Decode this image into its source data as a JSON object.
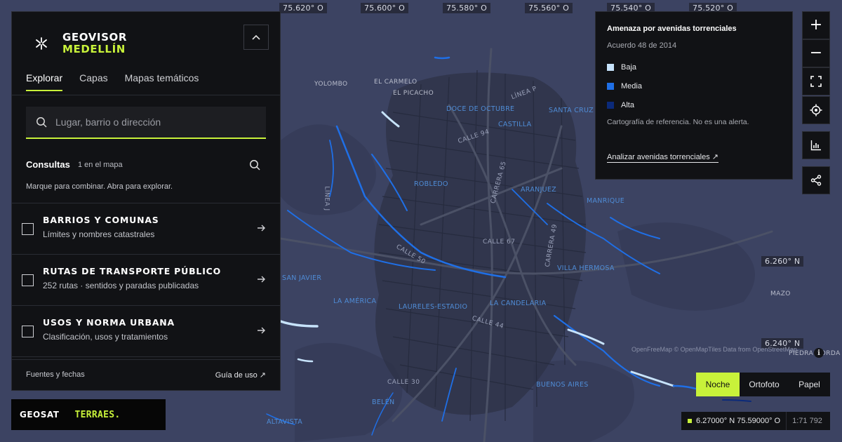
{
  "brand": {
    "line1": "GEOVISOR",
    "line2": "MEDELLÍN"
  },
  "tabs": [
    {
      "label": "Explorar",
      "active": true
    },
    {
      "label": "Capas",
      "active": false
    },
    {
      "label": "Mapas temáticos",
      "active": false
    }
  ],
  "search": {
    "placeholder": "Lugar, barrio o dirección"
  },
  "consultas": {
    "title": "Consultas",
    "count": "1 en el mapa",
    "hint": "Marque para combinar. Abra para explorar."
  },
  "layers": [
    {
      "title": "BARRIOS Y COMUNAS",
      "subtitle": "Límites y nombres catastrales",
      "checked": false
    },
    {
      "title": "RUTAS DE TRANSPORTE PÚBLICO",
      "subtitle": "252 rutas · sentidos y paradas publicadas",
      "checked": false
    },
    {
      "title": "USOS Y NORMA URBANA",
      "subtitle": "Clasificación, usos y tratamientos",
      "checked": false
    }
  ],
  "panel_footer": {
    "left": "Fuentes y fechas",
    "right": "Guía de uso ↗"
  },
  "logos": {
    "left": "GEOSAT",
    "right": "TERRAES."
  },
  "legend": {
    "title": "Amenaza por avenidas torrenciales",
    "subtitle": "Acuerdo 48 de 2014",
    "items": [
      {
        "label": "Baja",
        "color": "#c7e3fb"
      },
      {
        "label": "Media",
        "color": "#1f6fe6"
      },
      {
        "label": "Alta",
        "color": "#0b2a7a"
      }
    ],
    "note": "Cartografía de referencia. No es una alerta.",
    "link": "Analizar avenidas torrenciales ↗"
  },
  "toolbar": {
    "zoom_in": "+",
    "zoom_out": "−",
    "icons": [
      "fullscreen-icon",
      "locate-icon",
      "chart-icon",
      "share-icon"
    ]
  },
  "basemap": {
    "options": [
      {
        "label": "Noche",
        "active": true
      },
      {
        "label": "Ortofoto",
        "active": false
      },
      {
        "label": "Papel",
        "active": false
      }
    ]
  },
  "readout": {
    "coord": "6.27000° N 75.59000° O",
    "scale": "1:71 792"
  },
  "attribution": "OpenFreeMap © OpenMapTiles Data from OpenStreetMap",
  "map": {
    "top_coords": [
      "75.620° O",
      "75.600° O",
      "75.580° O",
      "75.560° O",
      "75.540° O",
      "75.520° O"
    ],
    "right_coords": [
      "6.260° N",
      "6.240° N"
    ],
    "streets": [
      "CALLE 94",
      "CARRERA 65",
      "CALLE 67",
      "CARRERA 49",
      "CALLE 50",
      "CALLE 44",
      "CALLE 30",
      "LÍNEA P",
      "LÍNEA J"
    ],
    "neighborhoods": [
      "DOCE DE OCTUBRE",
      "CASTILLA",
      "SANTA CRUZ",
      "ROBLEDO",
      "ARANJUEZ",
      "MANRIQUE",
      "VILLA HERMOSA",
      "LA AMÉRICA",
      "LAURELES-ESTADIO",
      "LA CANDELARIA",
      "BUENOS AIRES",
      "BELÉN",
      "ALTAVISTA",
      "SAN JAVIER"
    ],
    "places": [
      "YOLOMBO",
      "EL CARMELO",
      "EL PICACHO",
      "MAZO",
      "PIEDRA GORDA"
    ]
  }
}
